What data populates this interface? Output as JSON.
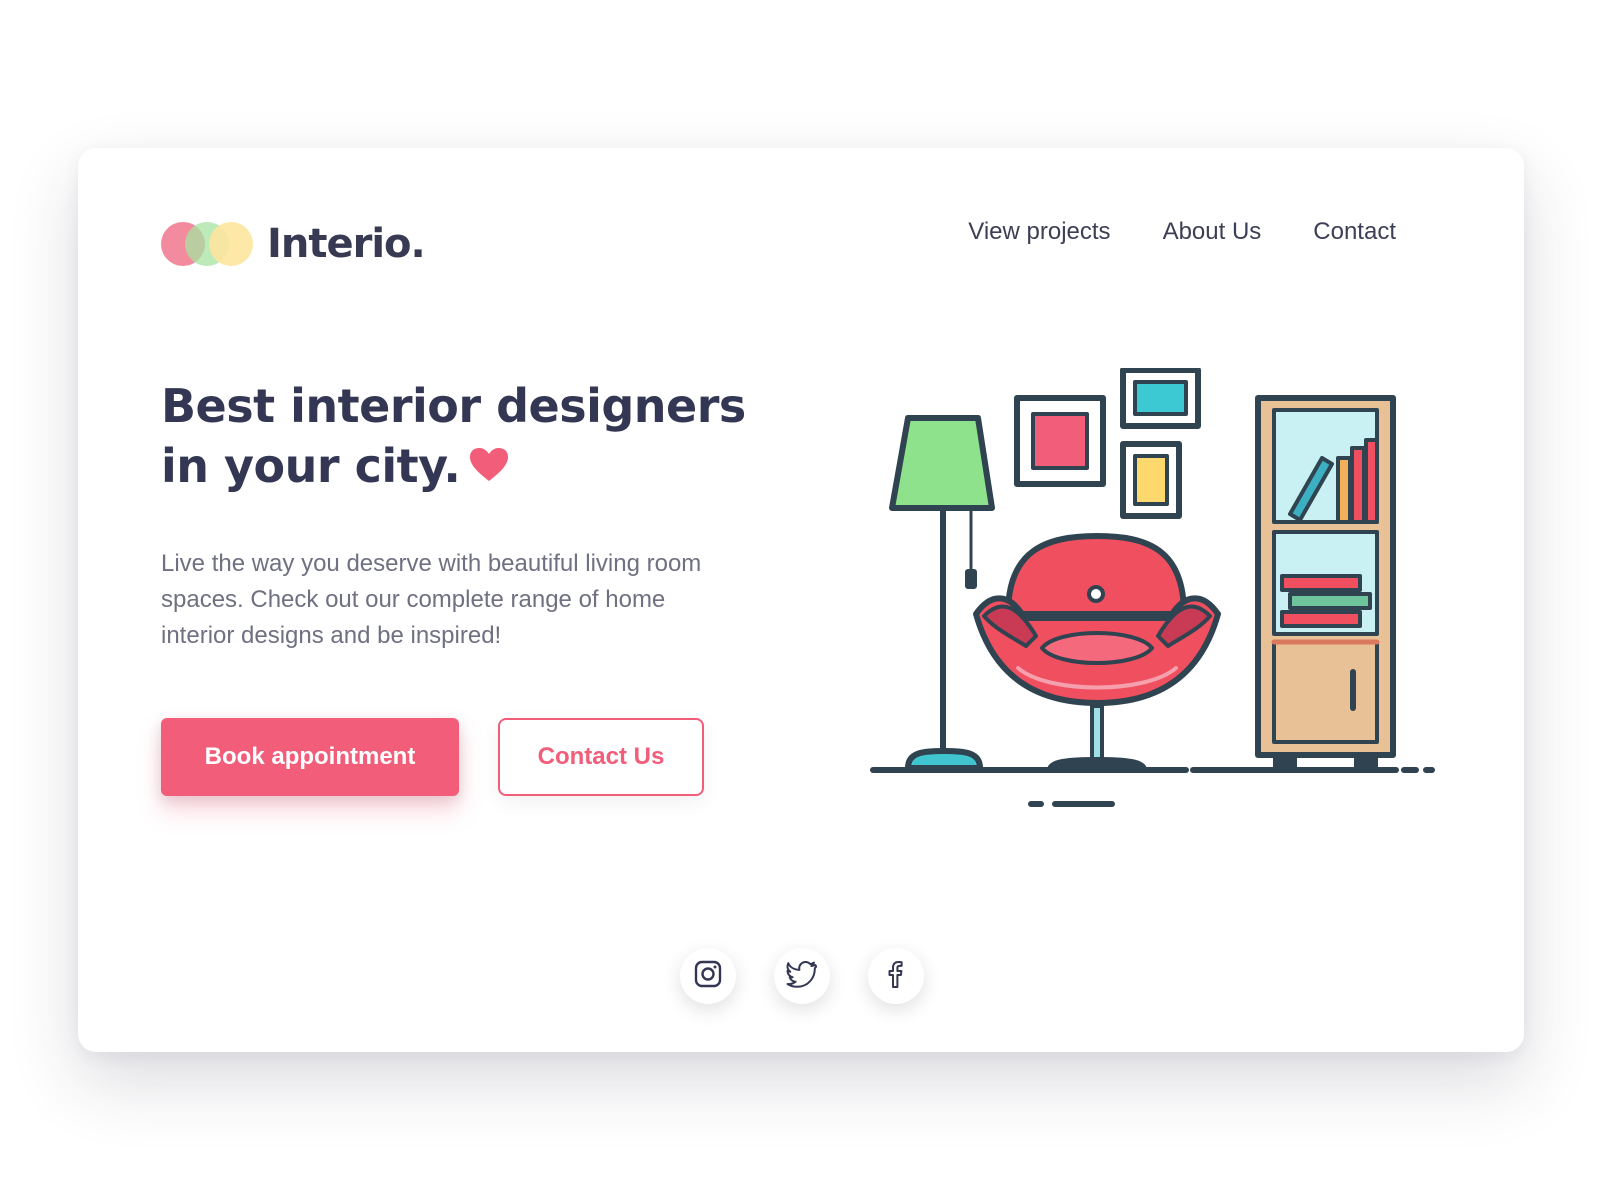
{
  "brand": {
    "name": "Interio.",
    "logo_colors": [
      "#f27e95",
      "#a6e3a1",
      "#fde59e"
    ]
  },
  "nav": {
    "items": [
      "View projects",
      "About Us",
      "Contact"
    ]
  },
  "hero": {
    "title_line1": "Best interior designers",
    "title_line2": "in your city.",
    "description": "Live the way you deserve with beautiful living room spaces. Check out our complete range of home interior designs and be inspired!",
    "primary_button": "Book appointment",
    "secondary_button": "Contact Us"
  },
  "social": {
    "icons": [
      "instagram-icon",
      "twitter-icon",
      "facebook-icon"
    ]
  },
  "colors": {
    "accent": "#f25d7a",
    "text_dark": "#343753",
    "text_muted": "#6f7182",
    "outline": "#2f4350"
  }
}
